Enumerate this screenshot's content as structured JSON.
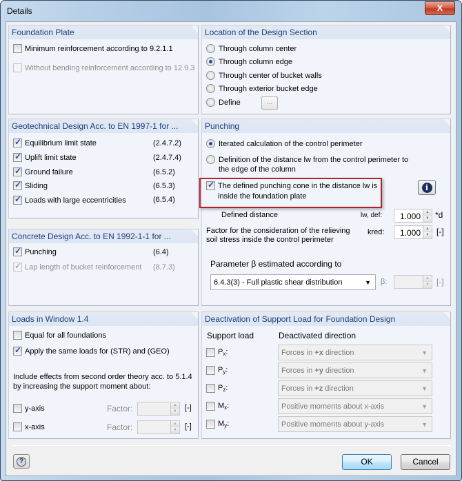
{
  "window": {
    "title": "Details",
    "close_label": "X"
  },
  "foundation_plate": {
    "title": "Foundation Plate",
    "items": [
      {
        "label": "Minimum reinforcement according to 9.2.1.1",
        "checked": false,
        "enabled": true
      },
      {
        "label": "Without bending reinforcement according to 12.9.3",
        "checked": false,
        "enabled": false
      }
    ]
  },
  "design_section": {
    "title": "Location of the Design Section",
    "options": [
      {
        "label": "Through column center",
        "selected": false
      },
      {
        "label": "Through column edge",
        "selected": true
      },
      {
        "label": "Through center of bucket walls",
        "selected": false
      },
      {
        "label": "Through exterior bucket edge",
        "selected": false
      },
      {
        "label": "Define",
        "selected": false
      }
    ],
    "define_button_label": "..."
  },
  "geotechnical": {
    "title": "Geotechnical Design Acc. to EN 1997-1 for ...",
    "items": [
      {
        "label": "Equilibrium limit state",
        "ref": "(2.4.7.2)",
        "checked": true
      },
      {
        "label": "Uplift limit state",
        "ref": "(2.4.7.4)",
        "checked": true
      },
      {
        "label": "Ground failure",
        "ref": "(6.5.2)",
        "checked": true
      },
      {
        "label": "Sliding",
        "ref": "(6.5.3)",
        "checked": true
      },
      {
        "label": "Loads with large eccentricities",
        "ref": "(6.5.4)",
        "checked": true
      }
    ]
  },
  "concrete": {
    "title": "Concrete Design Acc. to EN 1992-1-1 for ...",
    "items": [
      {
        "label": "Punching",
        "ref": "(6.4)",
        "checked": true,
        "enabled": true
      },
      {
        "label": "Lap length of bucket reinforcement",
        "ref": "(8.7.3)",
        "checked": true,
        "enabled": false
      }
    ]
  },
  "punching": {
    "title": "Punching",
    "option_iterated": "Iterated calculation of the control perimeter",
    "option_definition_line1": "Definition of the distance lw from the control perimeter to",
    "option_definition_line2": "the edge of the column",
    "cone_line1": "The defined punching cone in the distance lw is",
    "cone_line2": "inside the foundation plate",
    "cone_checked": true,
    "defined_distance_label": "Defined distance",
    "defined_distance_symbol": "lw, def:",
    "defined_distance_value": "1.000",
    "defined_distance_unit": "*d",
    "factor_line1": "Factor for the consideration of the relieving",
    "factor_line2": "soil stress inside the control perimeter",
    "factor_symbol": "kred:",
    "factor_value": "1.000",
    "factor_unit": "[-]",
    "beta_label": "Parameter β estimated according to",
    "beta_selected": "6.4.3(3) - Full plastic shear distribution",
    "beta_symbol": "β:",
    "beta_value": "",
    "beta_unit": "[-]"
  },
  "loads": {
    "title": "Loads in Window 1.4",
    "equal_label": "Equal for all foundations",
    "equal_checked": false,
    "same_loads_label": "Apply the same loads for (STR) and (GEO)",
    "same_loads_checked": true,
    "second_order_line1": "Include effects from second order theory acc. to 5.1.4",
    "second_order_line2": "by increasing the support moment about:",
    "axes": [
      {
        "label": "y-axis",
        "checked": false,
        "factor_label": "Factor:",
        "value": "",
        "unit": "[-]"
      },
      {
        "label": "x-axis",
        "checked": false,
        "factor_label": "Factor:",
        "value": "",
        "unit": "[-]"
      }
    ]
  },
  "deactivation": {
    "title": "Deactivation of Support Load for Foundation Design",
    "col_support": "Support load",
    "col_direction": "Deactivated direction",
    "rows": [
      {
        "sym": "P",
        "sub": "x",
        "direction_pre": "Forces in ",
        "direction_bold": "+x",
        "direction_post": " direction",
        "checked": false
      },
      {
        "sym": "P",
        "sub": "y",
        "direction_pre": "Forces in ",
        "direction_bold": "+y",
        "direction_post": " direction",
        "checked": false
      },
      {
        "sym": "P",
        "sub": "z",
        "direction_pre": "Forces in ",
        "direction_bold": "+z",
        "direction_post": " direction",
        "checked": false
      },
      {
        "sym": "M",
        "sub": "x",
        "direction_pre": "Positive moments about x-axis",
        "direction_bold": "",
        "direction_post": "",
        "checked": false
      },
      {
        "sym": "M",
        "sub": "y",
        "direction_pre": "Positive moments about y-axis",
        "direction_bold": "",
        "direction_post": "",
        "checked": false
      }
    ]
  },
  "footer": {
    "ok_label": "OK",
    "cancel_label": "Cancel",
    "help_icon": "?"
  },
  "colors": {
    "highlight": "#b2202a",
    "group_header_text": "#1e3f7a"
  }
}
